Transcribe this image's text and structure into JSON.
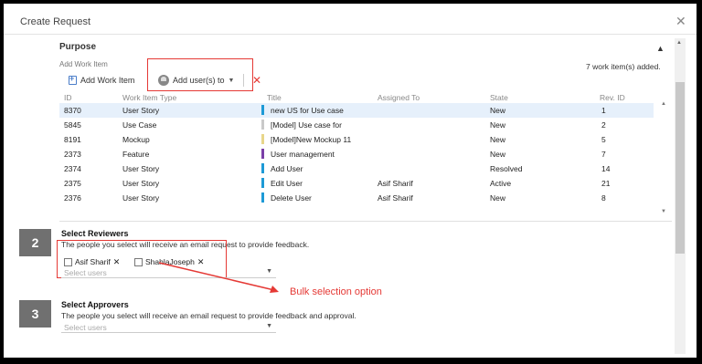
{
  "dialog": {
    "title": "Create Request",
    "close_glyph": "✕"
  },
  "purpose": {
    "title": "Purpose",
    "collapse_glyph": "▲"
  },
  "work_items": {
    "label": "Add Work Item",
    "count_text": "7 work item(s) added.",
    "toolbar": {
      "add_work_item": "Add Work Item",
      "add_users": "Add user(s) to",
      "dropdown_glyph": "▼",
      "delete_glyph": "✕"
    },
    "columns": [
      "ID",
      "Work Item Type",
      "Title",
      "Assigned To",
      "State",
      "Rev. ID"
    ],
    "rows": [
      {
        "id": "8370",
        "type": "User Story",
        "title": "new US for Use case",
        "assigned": "",
        "state": "New",
        "rev": "1",
        "color": "#1e9ad6",
        "selected": true
      },
      {
        "id": "5845",
        "type": "Use Case",
        "title": "[Model] Use case for",
        "assigned": "",
        "state": "New",
        "rev": "2",
        "color": "#c9c9c9",
        "selected": false
      },
      {
        "id": "8191",
        "type": "Mockup",
        "title": "[Model]New Mockup 11",
        "assigned": "",
        "state": "New",
        "rev": "5",
        "color": "#e8d68a",
        "selected": false
      },
      {
        "id": "2373",
        "type": "Feature",
        "title": "User management",
        "assigned": "",
        "state": "New",
        "rev": "7",
        "color": "#7b3fa8",
        "selected": false
      },
      {
        "id": "2374",
        "type": "User Story",
        "title": "Add User",
        "assigned": "",
        "state": "Resolved",
        "rev": "14",
        "color": "#1e9ad6",
        "selected": false
      },
      {
        "id": "2375",
        "type": "User Story",
        "title": "Edit User",
        "assigned": "Asif Sharif",
        "state": "Active",
        "rev": "21",
        "color": "#1e9ad6",
        "selected": false
      },
      {
        "id": "2376",
        "type": "User Story",
        "title": "Delete User",
        "assigned": "Asif Sharif",
        "state": "New",
        "rev": "8",
        "color": "#1e9ad6",
        "selected": false
      }
    ]
  },
  "reviewers": {
    "step": "2",
    "title": "Select Reviewers",
    "description": "The people you select will receive an email request to provide feedback.",
    "chips": [
      "Asif Sharif",
      "ShahlaJoseph"
    ],
    "chip_remove_glyph": "✕",
    "select_placeholder": "Select users"
  },
  "annotation": {
    "text": "Bulk selection option",
    "color": "#e53935"
  },
  "approvers": {
    "step": "3",
    "title": "Select Approvers",
    "description": "The people you select will receive an email request to provide feedback and approval.",
    "select_placeholder": "Select users"
  }
}
